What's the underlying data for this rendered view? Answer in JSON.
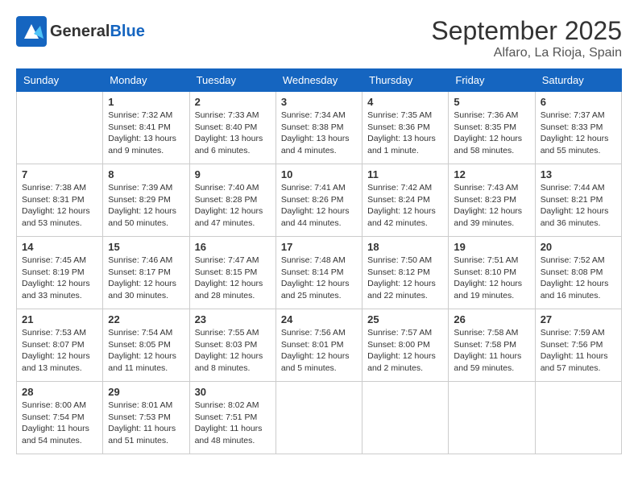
{
  "header": {
    "logo_general": "General",
    "logo_blue": "Blue",
    "month": "September 2025",
    "location": "Alfaro, La Rioja, Spain"
  },
  "weekdays": [
    "Sunday",
    "Monday",
    "Tuesday",
    "Wednesday",
    "Thursday",
    "Friday",
    "Saturday"
  ],
  "weeks": [
    [
      {
        "day": "",
        "sunrise": "",
        "sunset": "",
        "daylight": ""
      },
      {
        "day": "1",
        "sunrise": "Sunrise: 7:32 AM",
        "sunset": "Sunset: 8:41 PM",
        "daylight": "Daylight: 13 hours and 9 minutes."
      },
      {
        "day": "2",
        "sunrise": "Sunrise: 7:33 AM",
        "sunset": "Sunset: 8:40 PM",
        "daylight": "Daylight: 13 hours and 6 minutes."
      },
      {
        "day": "3",
        "sunrise": "Sunrise: 7:34 AM",
        "sunset": "Sunset: 8:38 PM",
        "daylight": "Daylight: 13 hours and 4 minutes."
      },
      {
        "day": "4",
        "sunrise": "Sunrise: 7:35 AM",
        "sunset": "Sunset: 8:36 PM",
        "daylight": "Daylight: 13 hours and 1 minute."
      },
      {
        "day": "5",
        "sunrise": "Sunrise: 7:36 AM",
        "sunset": "Sunset: 8:35 PM",
        "daylight": "Daylight: 12 hours and 58 minutes."
      },
      {
        "day": "6",
        "sunrise": "Sunrise: 7:37 AM",
        "sunset": "Sunset: 8:33 PM",
        "daylight": "Daylight: 12 hours and 55 minutes."
      }
    ],
    [
      {
        "day": "7",
        "sunrise": "Sunrise: 7:38 AM",
        "sunset": "Sunset: 8:31 PM",
        "daylight": "Daylight: 12 hours and 53 minutes."
      },
      {
        "day": "8",
        "sunrise": "Sunrise: 7:39 AM",
        "sunset": "Sunset: 8:29 PM",
        "daylight": "Daylight: 12 hours and 50 minutes."
      },
      {
        "day": "9",
        "sunrise": "Sunrise: 7:40 AM",
        "sunset": "Sunset: 8:28 PM",
        "daylight": "Daylight: 12 hours and 47 minutes."
      },
      {
        "day": "10",
        "sunrise": "Sunrise: 7:41 AM",
        "sunset": "Sunset: 8:26 PM",
        "daylight": "Daylight: 12 hours and 44 minutes."
      },
      {
        "day": "11",
        "sunrise": "Sunrise: 7:42 AM",
        "sunset": "Sunset: 8:24 PM",
        "daylight": "Daylight: 12 hours and 42 minutes."
      },
      {
        "day": "12",
        "sunrise": "Sunrise: 7:43 AM",
        "sunset": "Sunset: 8:23 PM",
        "daylight": "Daylight: 12 hours and 39 minutes."
      },
      {
        "day": "13",
        "sunrise": "Sunrise: 7:44 AM",
        "sunset": "Sunset: 8:21 PM",
        "daylight": "Daylight: 12 hours and 36 minutes."
      }
    ],
    [
      {
        "day": "14",
        "sunrise": "Sunrise: 7:45 AM",
        "sunset": "Sunset: 8:19 PM",
        "daylight": "Daylight: 12 hours and 33 minutes."
      },
      {
        "day": "15",
        "sunrise": "Sunrise: 7:46 AM",
        "sunset": "Sunset: 8:17 PM",
        "daylight": "Daylight: 12 hours and 30 minutes."
      },
      {
        "day": "16",
        "sunrise": "Sunrise: 7:47 AM",
        "sunset": "Sunset: 8:15 PM",
        "daylight": "Daylight: 12 hours and 28 minutes."
      },
      {
        "day": "17",
        "sunrise": "Sunrise: 7:48 AM",
        "sunset": "Sunset: 8:14 PM",
        "daylight": "Daylight: 12 hours and 25 minutes."
      },
      {
        "day": "18",
        "sunrise": "Sunrise: 7:50 AM",
        "sunset": "Sunset: 8:12 PM",
        "daylight": "Daylight: 12 hours and 22 minutes."
      },
      {
        "day": "19",
        "sunrise": "Sunrise: 7:51 AM",
        "sunset": "Sunset: 8:10 PM",
        "daylight": "Daylight: 12 hours and 19 minutes."
      },
      {
        "day": "20",
        "sunrise": "Sunrise: 7:52 AM",
        "sunset": "Sunset: 8:08 PM",
        "daylight": "Daylight: 12 hours and 16 minutes."
      }
    ],
    [
      {
        "day": "21",
        "sunrise": "Sunrise: 7:53 AM",
        "sunset": "Sunset: 8:07 PM",
        "daylight": "Daylight: 12 hours and 13 minutes."
      },
      {
        "day": "22",
        "sunrise": "Sunrise: 7:54 AM",
        "sunset": "Sunset: 8:05 PM",
        "daylight": "Daylight: 12 hours and 11 minutes."
      },
      {
        "day": "23",
        "sunrise": "Sunrise: 7:55 AM",
        "sunset": "Sunset: 8:03 PM",
        "daylight": "Daylight: 12 hours and 8 minutes."
      },
      {
        "day": "24",
        "sunrise": "Sunrise: 7:56 AM",
        "sunset": "Sunset: 8:01 PM",
        "daylight": "Daylight: 12 hours and 5 minutes."
      },
      {
        "day": "25",
        "sunrise": "Sunrise: 7:57 AM",
        "sunset": "Sunset: 8:00 PM",
        "daylight": "Daylight: 12 hours and 2 minutes."
      },
      {
        "day": "26",
        "sunrise": "Sunrise: 7:58 AM",
        "sunset": "Sunset: 7:58 PM",
        "daylight": "Daylight: 11 hours and 59 minutes."
      },
      {
        "day": "27",
        "sunrise": "Sunrise: 7:59 AM",
        "sunset": "Sunset: 7:56 PM",
        "daylight": "Daylight: 11 hours and 57 minutes."
      }
    ],
    [
      {
        "day": "28",
        "sunrise": "Sunrise: 8:00 AM",
        "sunset": "Sunset: 7:54 PM",
        "daylight": "Daylight: 11 hours and 54 minutes."
      },
      {
        "day": "29",
        "sunrise": "Sunrise: 8:01 AM",
        "sunset": "Sunset: 7:53 PM",
        "daylight": "Daylight: 11 hours and 51 minutes."
      },
      {
        "day": "30",
        "sunrise": "Sunrise: 8:02 AM",
        "sunset": "Sunset: 7:51 PM",
        "daylight": "Daylight: 11 hours and 48 minutes."
      },
      {
        "day": "",
        "sunrise": "",
        "sunset": "",
        "daylight": ""
      },
      {
        "day": "",
        "sunrise": "",
        "sunset": "",
        "daylight": ""
      },
      {
        "day": "",
        "sunrise": "",
        "sunset": "",
        "daylight": ""
      },
      {
        "day": "",
        "sunrise": "",
        "sunset": "",
        "daylight": ""
      }
    ]
  ]
}
